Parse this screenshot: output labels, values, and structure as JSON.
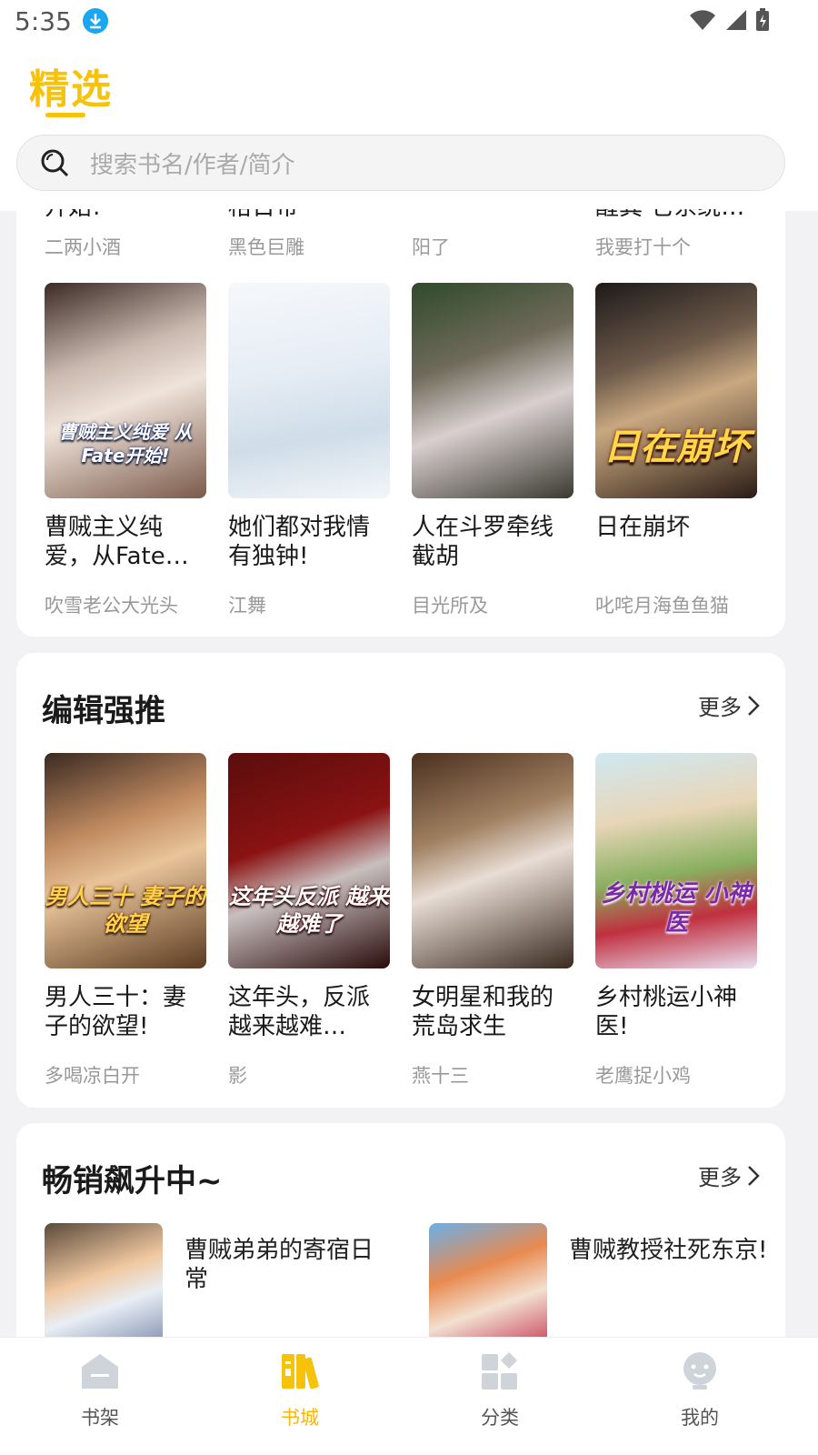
{
  "status_bar": {
    "time": "5:35"
  },
  "header": {
    "tab": "精选",
    "search_placeholder": "搜索书名/作者/简介"
  },
  "top_section": {
    "partial_books": [
      {
        "title_fragment": "开始!",
        "author": "二两小酒"
      },
      {
        "title_fragment": "格日帝",
        "author": "黑色巨雕"
      },
      {
        "title_fragment": "",
        "author": "阳了"
      },
      {
        "title_fragment": "醒異 它系统…",
        "author": "我要打十个"
      }
    ],
    "books": [
      {
        "title": "曹贼主义纯爱，从Fate…",
        "author": "吹雪老公大光头",
        "cover_text": "曹贼主义纯爱 从Fate开始!"
      },
      {
        "title": "她们都对我情有独钟!",
        "author": "江舞",
        "cover_text": ""
      },
      {
        "title": "人在斗罗牵线截胡",
        "author": "目光所及",
        "cover_text": ""
      },
      {
        "title": "日在崩坏",
        "author": "叱咤月海鱼鱼猫",
        "cover_text": "日在崩坏"
      }
    ]
  },
  "editor_section": {
    "title": "编辑强推",
    "more": "更多",
    "books": [
      {
        "title": "男人三十：妻子的欲望!",
        "author": "多喝凉白开",
        "cover_text": "男人三十 妻子的欲望"
      },
      {
        "title": "这年头，反派越来越难…",
        "author": "影",
        "cover_text": "这年头反派 越来越难了"
      },
      {
        "title": "女明星和我的荒岛求生",
        "author": "燕十三",
        "cover_text": ""
      },
      {
        "title": "乡村桃运小神医!",
        "author": "老鹰捉小鸡",
        "cover_text": "乡村桃运 小神医"
      }
    ]
  },
  "rising_section": {
    "title": "畅销飙升中~",
    "more": "更多",
    "books": [
      {
        "title": "曹贼弟弟的寄宿日常"
      },
      {
        "title": "曹贼教授社死东京!"
      }
    ]
  },
  "bottom_nav": {
    "items": [
      {
        "label": "书架",
        "icon": "bookshelf-icon",
        "active": false
      },
      {
        "label": "书城",
        "icon": "bookstore-icon",
        "active": true
      },
      {
        "label": "分类",
        "icon": "category-icon",
        "active": false
      },
      {
        "label": "我的",
        "icon": "profile-icon",
        "active": false
      }
    ]
  },
  "colors": {
    "accent": "#f6c20a",
    "background": "#f2f2f4"
  }
}
